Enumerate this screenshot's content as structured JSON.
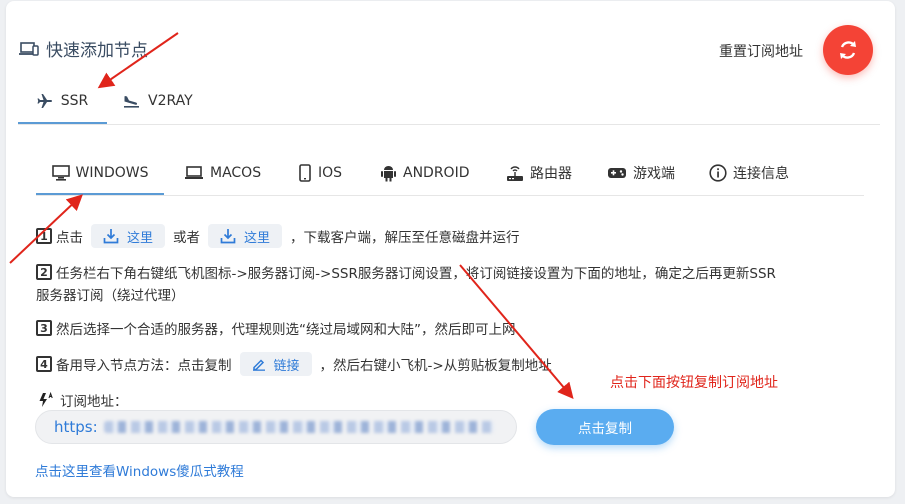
{
  "header": {
    "title": "快速添加节点",
    "reset_label": "重置订阅地址"
  },
  "protocol_tabs": [
    {
      "label": "SSR",
      "icon": "airplane-icon",
      "active": true
    },
    {
      "label": "V2RAY",
      "icon": "airplane-landing-icon",
      "active": false
    }
  ],
  "os_tabs": [
    {
      "label": "WINDOWS",
      "icon": "monitor-icon"
    },
    {
      "label": "MACOS",
      "icon": "laptop-icon"
    },
    {
      "label": "IOS",
      "icon": "phone-icon"
    },
    {
      "label": "ANDROID",
      "icon": "android-icon"
    },
    {
      "label": "路由器",
      "icon": "router-icon"
    },
    {
      "label": "游戏端",
      "icon": "gamepad-icon"
    },
    {
      "label": "连接信息",
      "icon": "info-icon"
    }
  ],
  "steps": {
    "s1": {
      "num": "1",
      "text_a": "点击",
      "btn1": "这里",
      "mid": "或者",
      "btn2": "这里",
      "text_b": "，下载客户端，解压至任意磁盘并运行"
    },
    "s2": {
      "num": "2",
      "line1": "任务栏右下角右键纸飞机图标->服务器订阅->SSR服务器订阅设置，将订阅链接设置为下面的地址，确定之后再更新SSR",
      "line2": "服务器订阅（绕过代理）"
    },
    "s3": {
      "num": "3",
      "text": "然后选择一个合适的服务器，代理规则选“绕过局域网和大陆”，然后即可上网"
    },
    "s4": {
      "num": "4",
      "text_a": "备用导入节点方法：点击复制",
      "link_btn": "链接",
      "text_b": "，然后右键小飞机->从剪贴板复制地址"
    }
  },
  "subscription": {
    "label": "订阅地址：",
    "url_prefix": "https:"
  },
  "copy_button": "点击复制",
  "red_hint": "点击下面按钮复制订阅地址",
  "tutorial_link": "点击这里查看Windows傻瓜式教程",
  "colors": {
    "accent": "#5aacf0",
    "link": "#2f7bd8",
    "reset": "#f44336",
    "annotation": "#e0251b"
  }
}
